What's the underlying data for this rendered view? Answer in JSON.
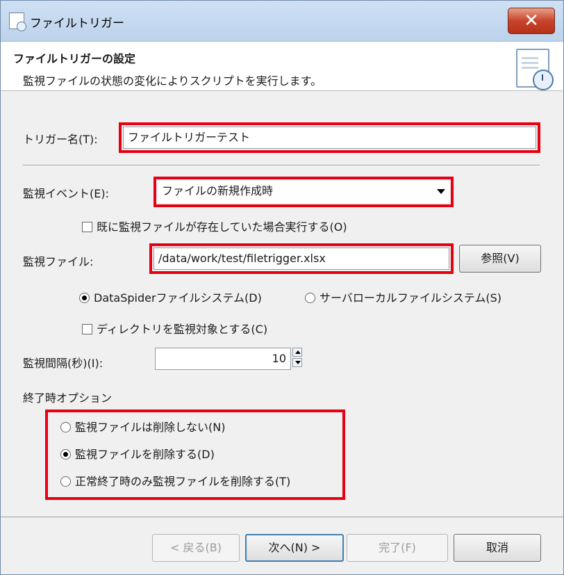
{
  "window": {
    "title": "ファイルトリガー",
    "close_label": "✕"
  },
  "header": {
    "title": "ファイルトリガーの設定",
    "description": "監視ファイルの状態の変化によりスクリプトを実行します。"
  },
  "trigger_name": {
    "label": "トリガー名(T):",
    "value": "ファイルトリガーテスト"
  },
  "watch_event": {
    "label": "監視イベント(E):",
    "selected": "ファイルの新規作成時",
    "checkbox_label": "既に監視ファイルが存在していた場合実行する(O)",
    "checked": false
  },
  "watch_file": {
    "label": "監視ファイル:",
    "value": "/data/work/test/filetrigger.xlsx",
    "browse_label": "参照(V)",
    "fs_options": [
      {
        "label": "DataSpiderファイルシステム(D)",
        "selected": true
      },
      {
        "label": "サーバローカルファイルシステム(S)",
        "selected": false
      }
    ],
    "dir_checkbox_label": "ディレクトリを監視対象とする(C)",
    "dir_checked": false
  },
  "interval": {
    "label": "監視間隔(秒)(I):",
    "value": "10"
  },
  "end_options": {
    "heading": "終了時オプション",
    "options": [
      {
        "label": "監視ファイルは削除しない(N)",
        "selected": false
      },
      {
        "label": "監視ファイルを削除する(D)",
        "selected": true
      },
      {
        "label": "正常終了時のみ監視ファイルを削除する(T)",
        "selected": false
      }
    ]
  },
  "footer": {
    "back": "< 戻る(B)",
    "next": "次へ(N) >",
    "finish": "完了(F)",
    "cancel": "取消"
  },
  "colors": {
    "highlight": "#e60012",
    "titlebar": "#c6dbf1",
    "close": "#c8442b"
  }
}
